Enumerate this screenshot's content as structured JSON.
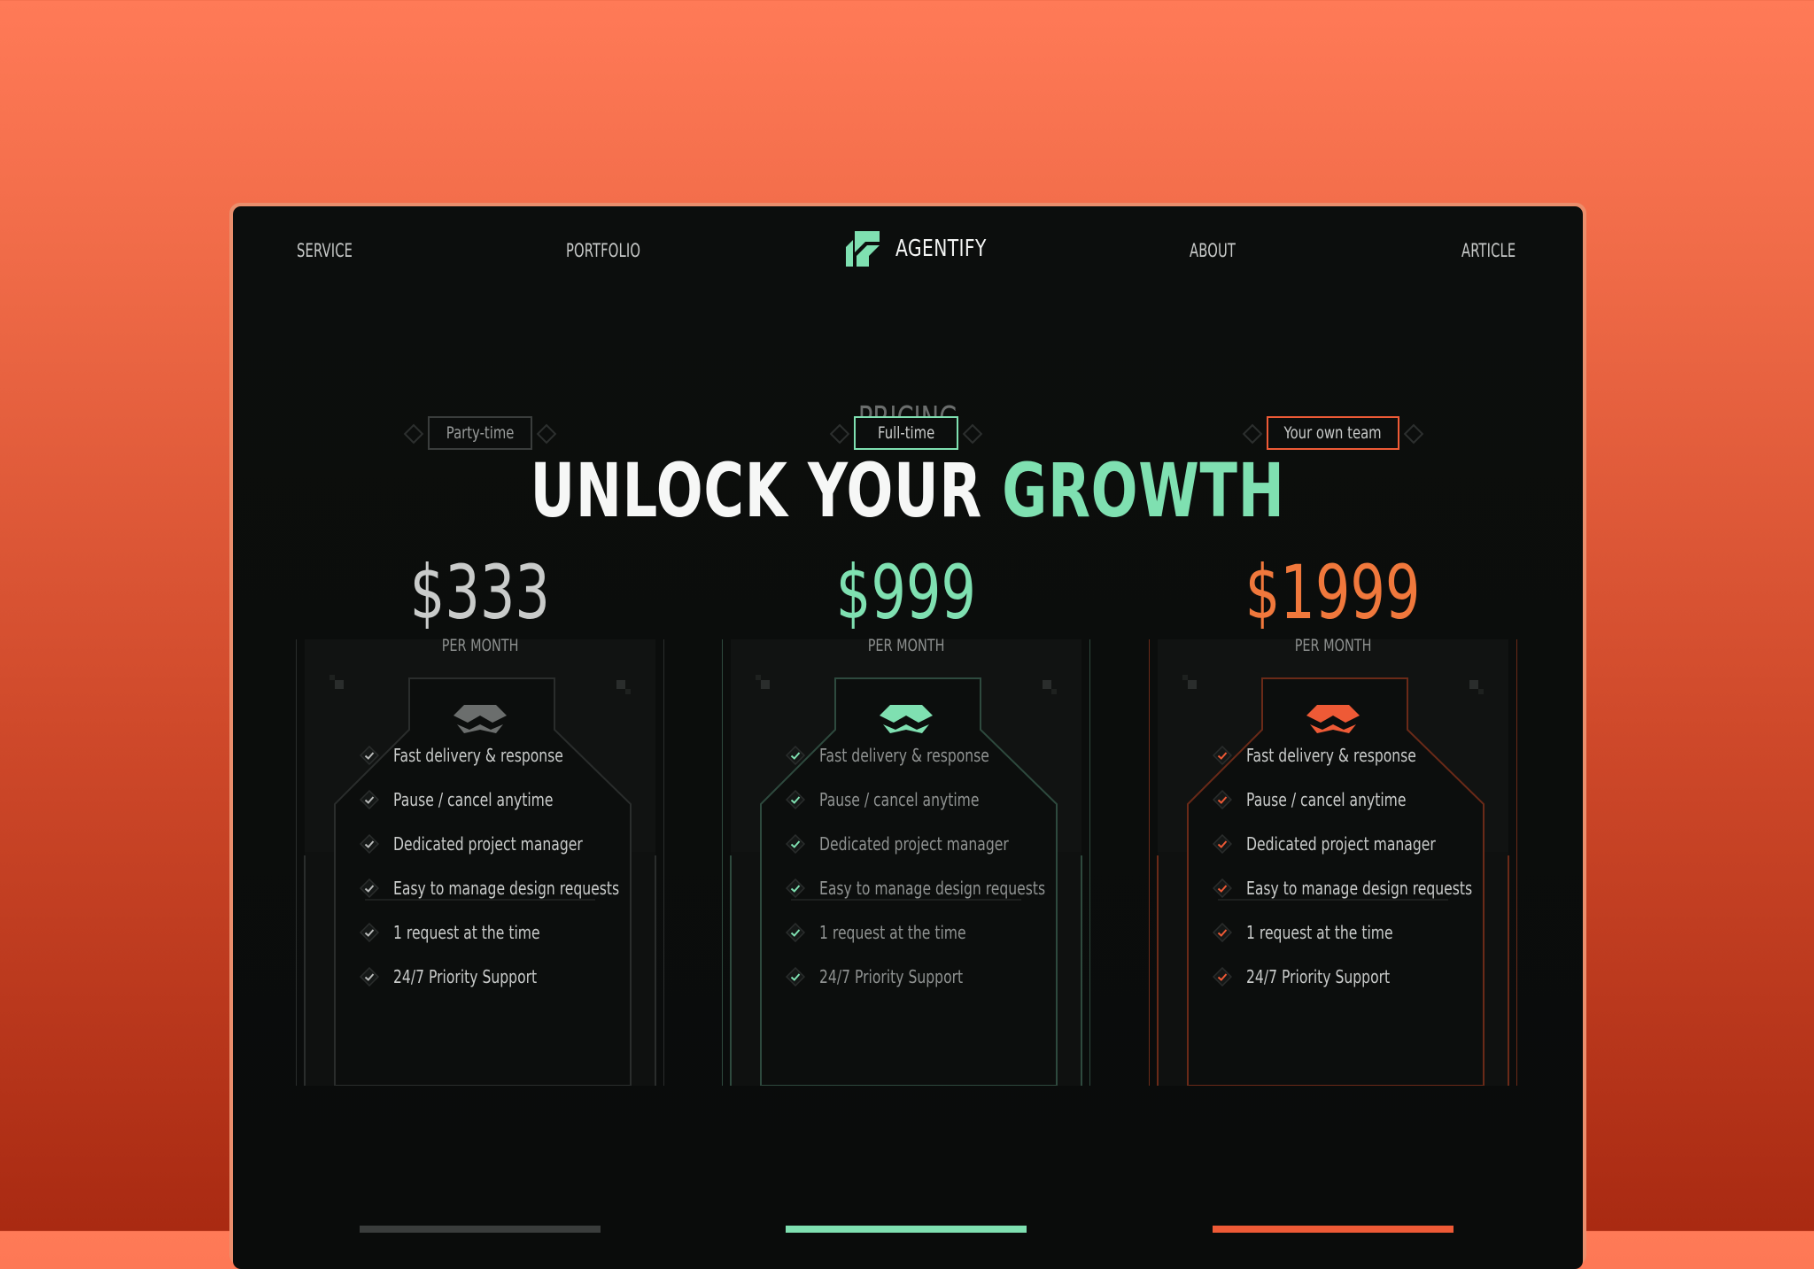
{
  "nav": {
    "left": [
      "SERVICE",
      "PORTFOLIO"
    ],
    "right": [
      "ABOUT",
      "ARTICLE"
    ],
    "brand": "AGENTIFY"
  },
  "hero": {
    "eyebrow": "PRICING",
    "headline_main": "UNLOCK YOUR ",
    "headline_accent": "GROWTH"
  },
  "plans": [
    {
      "tag": "Party-time",
      "price": "$333",
      "period": "PER MONTH",
      "accent": "#6b6e6d",
      "price_color": "#c9cbca",
      "features": [
        "Fast delivery & response",
        "Pause / cancel anytime",
        "Dedicated project manager",
        "Easy to manage design requests",
        "1 request at the time",
        "24/7 Priority Support"
      ]
    },
    {
      "tag": "Full-time",
      "price": "$999",
      "period": "PER MONTH",
      "accent": "#7fe0b1",
      "price_color": "#7fe0b1",
      "features": [
        "Fast delivery & response",
        "Pause / cancel anytime",
        "Dedicated project manager",
        "Easy to manage design requests",
        "1 request at the time",
        "24/7 Priority Support"
      ]
    },
    {
      "tag": "Your own team",
      "price": "$1999",
      "period": "PER MONTH",
      "accent": "#ee5a36",
      "price_color": "#f0783c",
      "features": [
        "Fast delivery & response",
        "Pause / cancel anytime",
        "Dedicated project manager",
        "Easy to manage design requests",
        "1 request at the time",
        "24/7 Priority Support"
      ]
    }
  ],
  "colors": {
    "page_bg_top": "#ff7a57",
    "page_bg_bottom": "#a92a12",
    "window_bg": "#0b0d0c",
    "green": "#7fe0b1",
    "orange": "#ee5a36"
  },
  "icons": [
    "logo-icon",
    "plan-emblem-icon",
    "check-icon"
  ]
}
